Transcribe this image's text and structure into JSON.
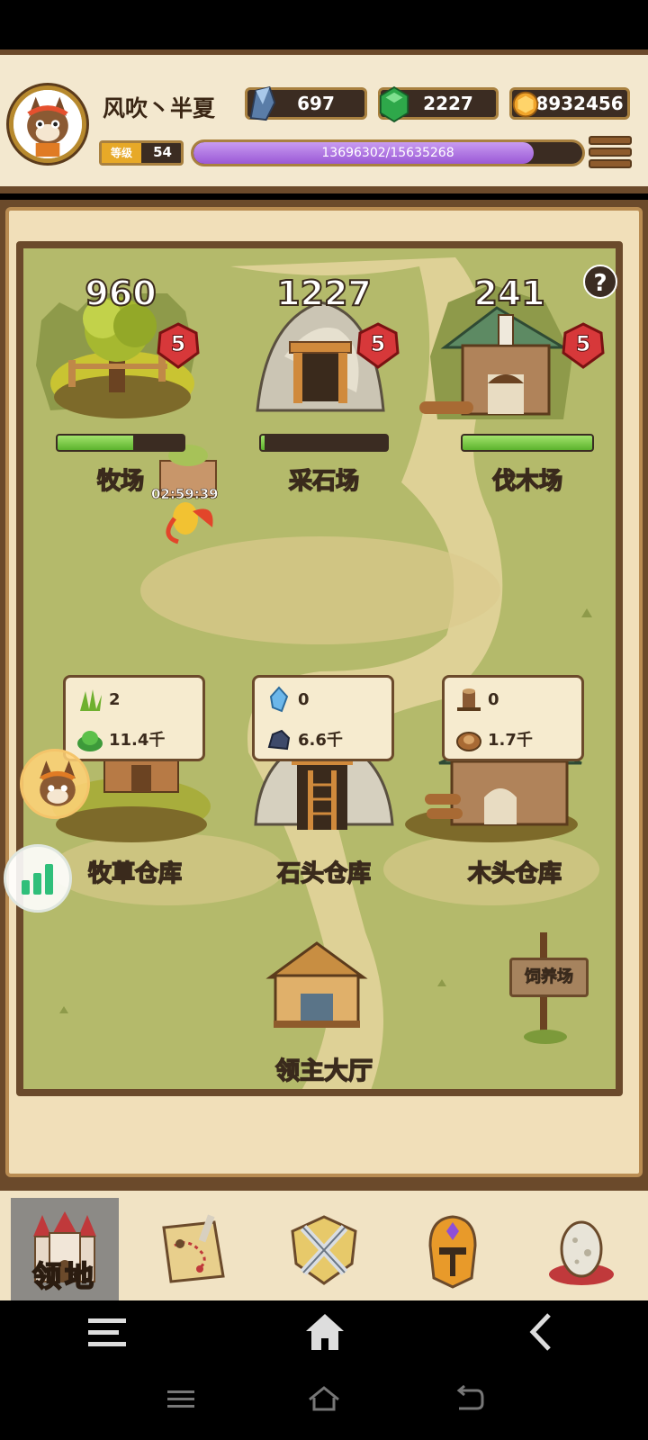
{
  "header": {
    "player_name": "风吹丶半夏",
    "resources": [
      {
        "icon": "ore-crystal-icon",
        "value": "697"
      },
      {
        "icon": "green-gem-icon",
        "value": "2227"
      },
      {
        "icon": "gold-coin-icon",
        "value": "8932456"
      }
    ],
    "level_tag": "等级",
    "level": "54",
    "xp_text": "13696302/15635268",
    "xp_fraction": 0.876
  },
  "map": {
    "help_label": "?",
    "producers": [
      {
        "name": "牧场",
        "count": "960",
        "level": "5",
        "progress": 0.6
      },
      {
        "name": "采石场",
        "count": "1227",
        "level": "5",
        "progress": 0.03
      },
      {
        "name": "伐木场",
        "count": "241",
        "level": "5",
        "progress": 1.0
      }
    ],
    "timer": "02:59:39",
    "storages": [
      {
        "name": "牧草仓库",
        "row1_icon": "grass-sprout-icon",
        "row1": "2",
        "row2_icon": "grass-bush-icon",
        "row2": "11.4千"
      },
      {
        "name": "石头仓库",
        "row1_icon": "blue-crystal-icon",
        "row1": "0",
        "row2_icon": "stone-ore-icon",
        "row2": "6.6千"
      },
      {
        "name": "木头仓库",
        "row1_icon": "tree-stump-icon",
        "row1": "0",
        "row2_icon": "wood-log-icon",
        "row2": "1.7千"
      }
    ],
    "hall_label": "领主大厅",
    "sign_label": "饲养场"
  },
  "bottom_nav": {
    "active_label": "领地",
    "items": [
      "castle-icon",
      "map-scroll-icon",
      "crossed-swords-icon",
      "knight-helmet-icon",
      "egg-icon"
    ]
  },
  "colors": {
    "xp_purple": "#9b58d6",
    "progress_green": "#5cb22d",
    "frame_brown": "#6b4a2b",
    "grass": "#b4ba6b"
  }
}
